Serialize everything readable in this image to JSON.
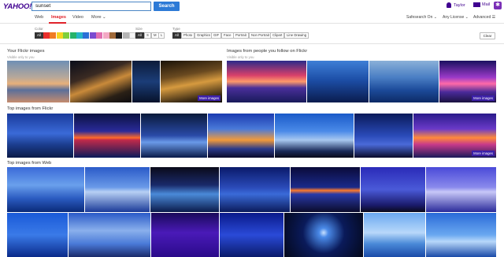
{
  "header": {
    "logo": "YAHOO!",
    "search_value": "sunset",
    "search_button": "Search",
    "user_name": "Taylor",
    "mail_label": "Mail"
  },
  "nav": {
    "tabs": [
      "Web",
      "Images",
      "Video",
      "More ⌄"
    ],
    "active_tab": "Images",
    "safesearch": "Safesearch On ⌄",
    "license": "Any License ⌄",
    "advanced": "Advanced ☰"
  },
  "filters": {
    "color_label": "Color",
    "color_all": "All",
    "colors": [
      "#e82e2b",
      "#f07c22",
      "#f6d51f",
      "#7fcf3c",
      "#27b36a",
      "#26b4c8",
      "#2b6fd6",
      "#7a4bd0",
      "#e06fb0",
      "#f3a9c4",
      "#a06a3a",
      "#1b1b1b",
      "#b5b5b5",
      "#f4f4f4"
    ],
    "size_label": "Size",
    "sizes": [
      "All",
      "S",
      "M",
      "L"
    ],
    "size_selected": "All",
    "type_label": "Type",
    "types": [
      "All",
      "Photo",
      "Graphics",
      "GIF",
      "Face",
      "Portrait",
      "Non Portrait",
      "Clipart",
      "Line Drawing"
    ],
    "type_selected": "All",
    "clear": "Clear"
  },
  "sections": {
    "your_flickr": {
      "title": "Your Flickr images",
      "subtitle": "Visible only to you",
      "more": "More images"
    },
    "people_follow": {
      "title": "Images from people you follow on Flickr",
      "subtitle": "Visible only to you",
      "more": "More images"
    },
    "top_flickr": {
      "title": "Top images from Flickr",
      "more": "More images"
    },
    "top_web": {
      "title": "Top images from Web"
    }
  }
}
